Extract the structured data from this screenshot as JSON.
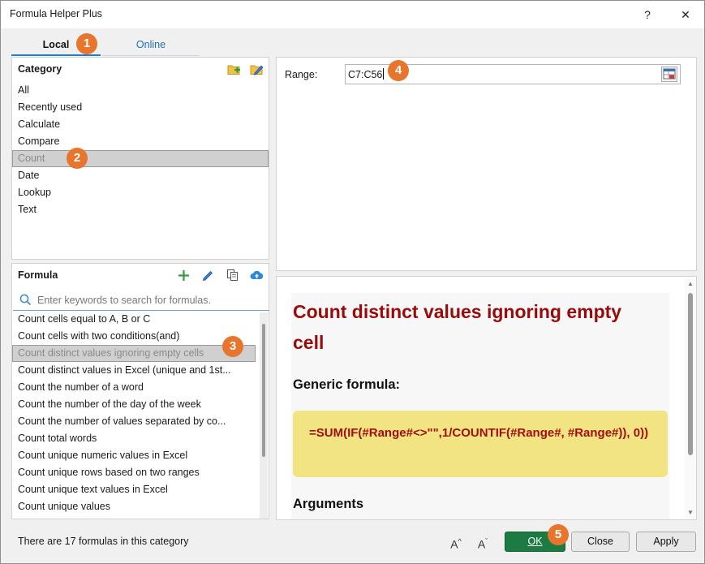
{
  "window": {
    "title": "Formula Helper Plus",
    "help_glyph": "?",
    "close_glyph": "✕"
  },
  "tabs": [
    {
      "label": "Local",
      "active": true
    },
    {
      "label": "Online",
      "active": false
    }
  ],
  "category": {
    "header": "Category",
    "items": [
      "All",
      "Recently used",
      "Calculate",
      "Compare",
      "Count",
      "Date",
      "Lookup",
      "Text"
    ],
    "selected": "Count",
    "icons": [
      "add-folder-icon",
      "edit-folder-icon"
    ]
  },
  "formula": {
    "header": "Formula",
    "search_placeholder": "Enter keywords to search for formulas.",
    "items": [
      "Count cells equal to A, B or C",
      "Count cells with two conditions(and)",
      "Count distinct values ignoring empty cells",
      "Count distinct values in Excel (unique and 1st...",
      "Count the number of a word",
      "Count the number of the day of the week",
      "Count the number of values separated by co...",
      "Count total words",
      "Count unique numeric values in Excel",
      "Count unique rows based on two ranges",
      "Count unique text values in Excel",
      "Count unique values"
    ],
    "selected": "Count distinct values ignoring empty cells",
    "icons": [
      "plus-icon",
      "pencil-icon",
      "copy-icon",
      "cloud-upload-icon"
    ]
  },
  "range": {
    "label": "Range:",
    "value": "C7:C56"
  },
  "help": {
    "title": "Count distinct values ignoring empty cell",
    "subtitle": "Generic formula:",
    "formula": "=SUM(IF(#Range#<>\"\",1/COUNTIF(#Range#, #Range#)), 0))",
    "section": "Arguments"
  },
  "status": {
    "text": "There are 17 formulas in this category"
  },
  "buttons": {
    "ok": "OK",
    "close": "Close",
    "apply": "Apply"
  },
  "badges": [
    "1",
    "2",
    "3",
    "4",
    "5"
  ],
  "colors": {
    "accent": "#1e7fd6",
    "ok_green": "#1c7a43",
    "badge_orange": "#e8752c",
    "help_title": "#9a0a0a",
    "formula_bg": "#f3e483"
  }
}
